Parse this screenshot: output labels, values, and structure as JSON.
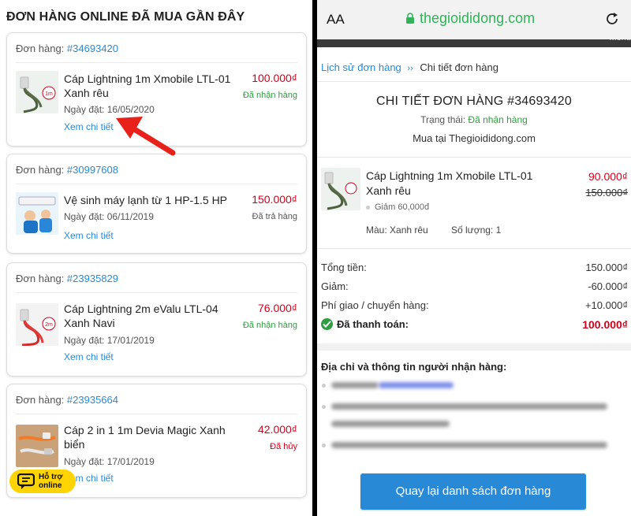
{
  "left": {
    "title": "ĐƠN HÀNG ONLINE ĐÃ MUA GẦN ĐÂY",
    "order_label": "Đơn hàng:",
    "date_label": "Ngày đặt:",
    "detail_label": "Xem chi tiết",
    "orders": [
      {
        "id": "#34693420",
        "product": "Cáp Lightning 1m Xmobile LTL-01 Xanh rêu",
        "price": "100.000₫",
        "status": "Đã nhận hàng",
        "date": "16/05/2020"
      },
      {
        "id": "#30997608",
        "product": "Vệ sinh máy lạnh từ 1 HP-1.5 HP",
        "price": "150.000₫",
        "status": "Đã trả hàng",
        "date": "06/11/2019"
      },
      {
        "id": "#23935829",
        "product": "Cáp Lightning 2m eValu LTL-04 Xanh Navi",
        "price": "76.000₫",
        "status": "Đã nhận hàng",
        "date": "17/01/2019"
      },
      {
        "id": "#23935664",
        "product": "Cáp 2 in 1 1m Devia Magic Xanh biển",
        "price": "42.000₫",
        "status": "Đã hủy",
        "date": "17/01/2019"
      }
    ],
    "support": {
      "line1": "Hỗ trợ",
      "line2": "online"
    },
    "colors": {
      "link": "#288ad6",
      "price": "#d0021b",
      "success": "#2e9e3f",
      "arrow": "#e8221b",
      "support_bg": "#ffd400"
    },
    "icons": {
      "arrow": "red-arrow-icon",
      "chat": "chat-bubble-icon"
    }
  },
  "browser": {
    "text_size": "AA",
    "url": "thegioididong.com",
    "menu": "Menu",
    "icons": {
      "lock": "lock-icon",
      "reload": "reload-icon"
    }
  },
  "detail": {
    "breadcrumb": {
      "parent": "Lịch sử đơn hàng",
      "separator": "››",
      "current": "Chi tiết đơn hàng"
    },
    "title": "CHI TIẾT ĐƠN HÀNG #34693420",
    "status_label": "Trạng thái:",
    "status_value": "Đã nhận hàng",
    "shop": "Mua tại Thegioididong.com",
    "item": {
      "name": "Cáp Lightning 1m Xmobile LTL-01 Xanh rêu",
      "price": "90.000₫",
      "old_price": "150.000₫",
      "discount": "Giảm 60,000đ",
      "color": "Màu: Xanh rêu",
      "quantity": "Số lượng: 1"
    },
    "summary": [
      {
        "label": "Tổng tiền:",
        "value": "150.000₫"
      },
      {
        "label": "Giảm:",
        "value": "-60.000₫"
      },
      {
        "label": "Phí giao / chuyển hàng:",
        "value": "+10.000₫"
      }
    ],
    "paid": {
      "label": "Đã thanh toán:",
      "value": "100.000₫"
    },
    "address_title": "Địa chỉ và thông tin người nhận hàng:",
    "back_button": "Quay lại danh sách đơn hàng"
  }
}
